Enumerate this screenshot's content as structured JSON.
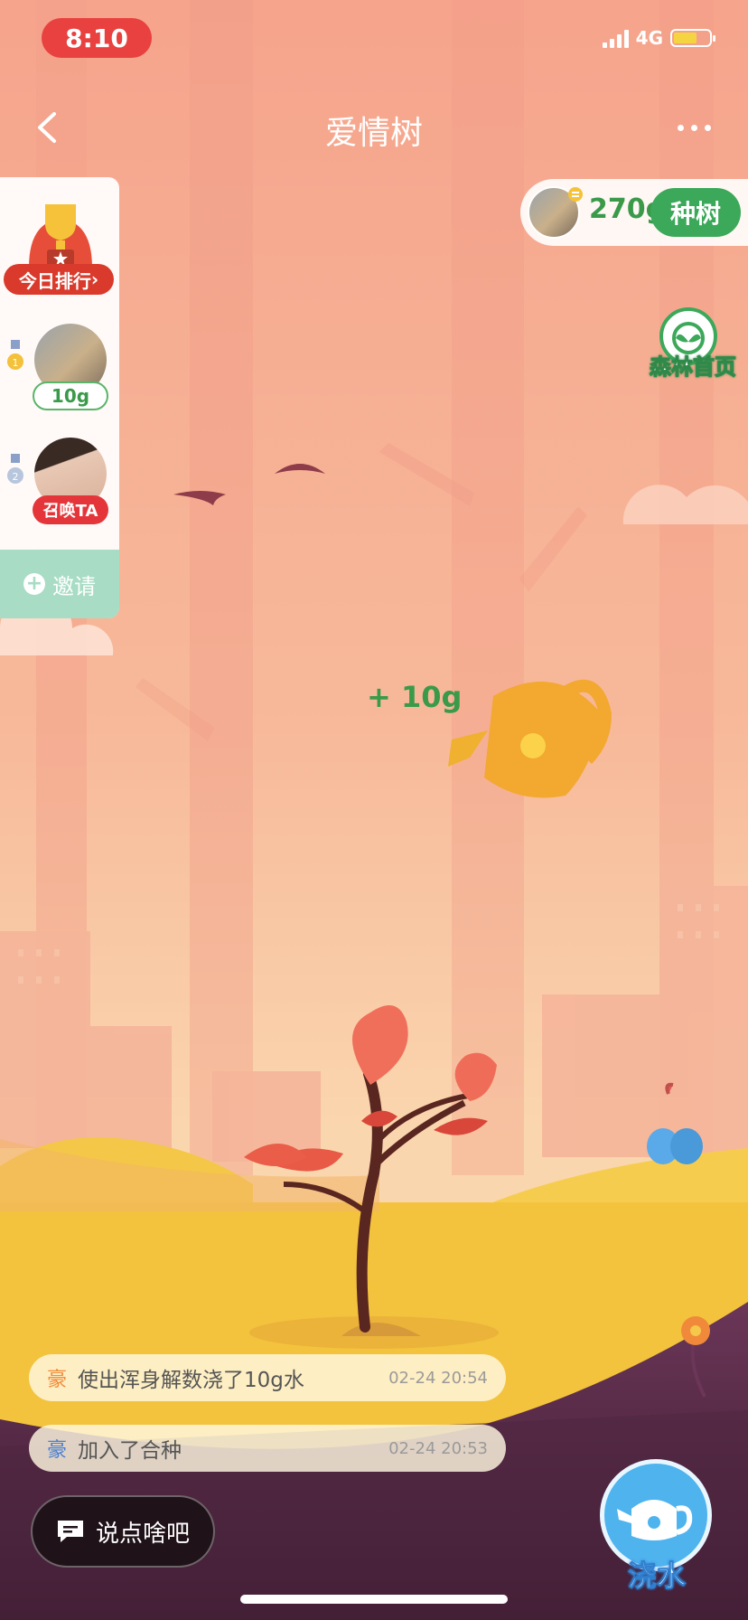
{
  "status_bar": {
    "time": "8:10",
    "network": "4G",
    "battery_level": 0.65
  },
  "header": {
    "title": "爱情树",
    "back_icon": "chevron-left-icon",
    "more_icon": "more-dots-icon"
  },
  "ranking": {
    "today_rank_label": "今日排行",
    "members": [
      {
        "rank": 1,
        "grams": "10g"
      },
      {
        "rank": 2,
        "action_label": "召唤TA"
      }
    ],
    "invite_label": "邀请"
  },
  "user_chip": {
    "grams": "270g",
    "plant_button": "种树"
  },
  "forest_home": {
    "label": "森林首页"
  },
  "watering": {
    "gain_text": "+ 10g"
  },
  "messages": [
    {
      "tag": "豪",
      "text": "使出浑身解数浇了10g水",
      "time": "02-24 20:54"
    },
    {
      "tag": "豪",
      "text": "加入了合种",
      "time": "02-24 20:53"
    }
  ],
  "chat_input": {
    "placeholder": "说点啥吧"
  },
  "water_button": {
    "label": "浇水"
  },
  "colors": {
    "sky_top": "#f7a78d",
    "ground": "#f2c23c",
    "accent_green": "#3ba85a",
    "water_blue": "#4fb3ee"
  }
}
